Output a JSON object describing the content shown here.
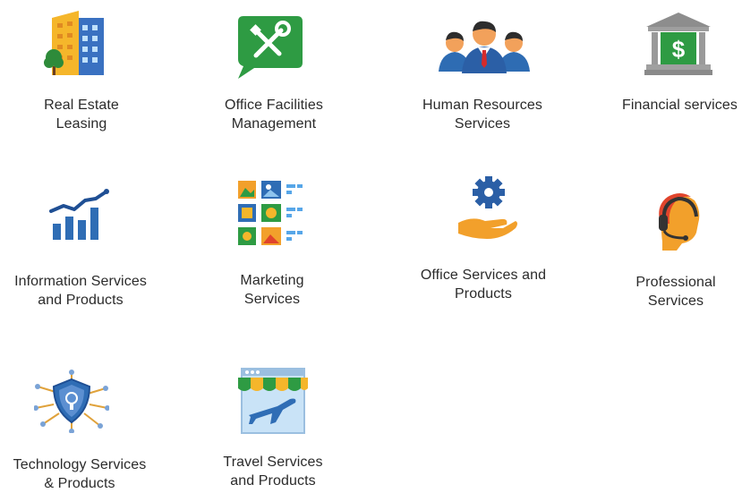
{
  "tiles": [
    {
      "name": "real-estate-leasing",
      "lines": [
        "Real Estate",
        "Leasing"
      ]
    },
    {
      "name": "office-facilities-management",
      "lines": [
        "Office Facilities",
        "Management"
      ]
    },
    {
      "name": "human-resources-services",
      "lines": [
        "Human Resources",
        "Services"
      ]
    },
    {
      "name": "financial-services",
      "lines": [
        "Financial services"
      ]
    },
    {
      "name": "information-services-and-products",
      "lines": [
        "Information Services",
        "and Products"
      ]
    },
    {
      "name": "marketing-services",
      "lines": [
        "Marketing",
        "Services"
      ]
    },
    {
      "name": "office-services-and-products",
      "lines": [
        "Office Services and",
        "Products"
      ]
    },
    {
      "name": "professional-services",
      "lines": [
        "Professional",
        "Services"
      ]
    },
    {
      "name": "technology-services-and-products",
      "lines": [
        "Technology Services",
        "& Products"
      ]
    },
    {
      "name": "travel-services-and-products",
      "lines": [
        "Travel Services",
        "and Products"
      ]
    }
  ],
  "icons": {
    "real_estate": "building-icon",
    "facilities": "tools-icon",
    "hr": "people-icon",
    "financial": "bank-icon",
    "information": "chart-icon",
    "marketing": "image-grid-icon",
    "office": "gear-hand-icon",
    "professional": "headset-icon",
    "technology": "shield-network-icon",
    "travel": "airplane-storefront-icon"
  },
  "colors": {
    "yellow": "#f5b62b",
    "green": "#2e9b43",
    "blue": "#2f6db5",
    "orange": "#f2a02b",
    "red": "#e0442c",
    "gray": "#8d8d8d"
  }
}
